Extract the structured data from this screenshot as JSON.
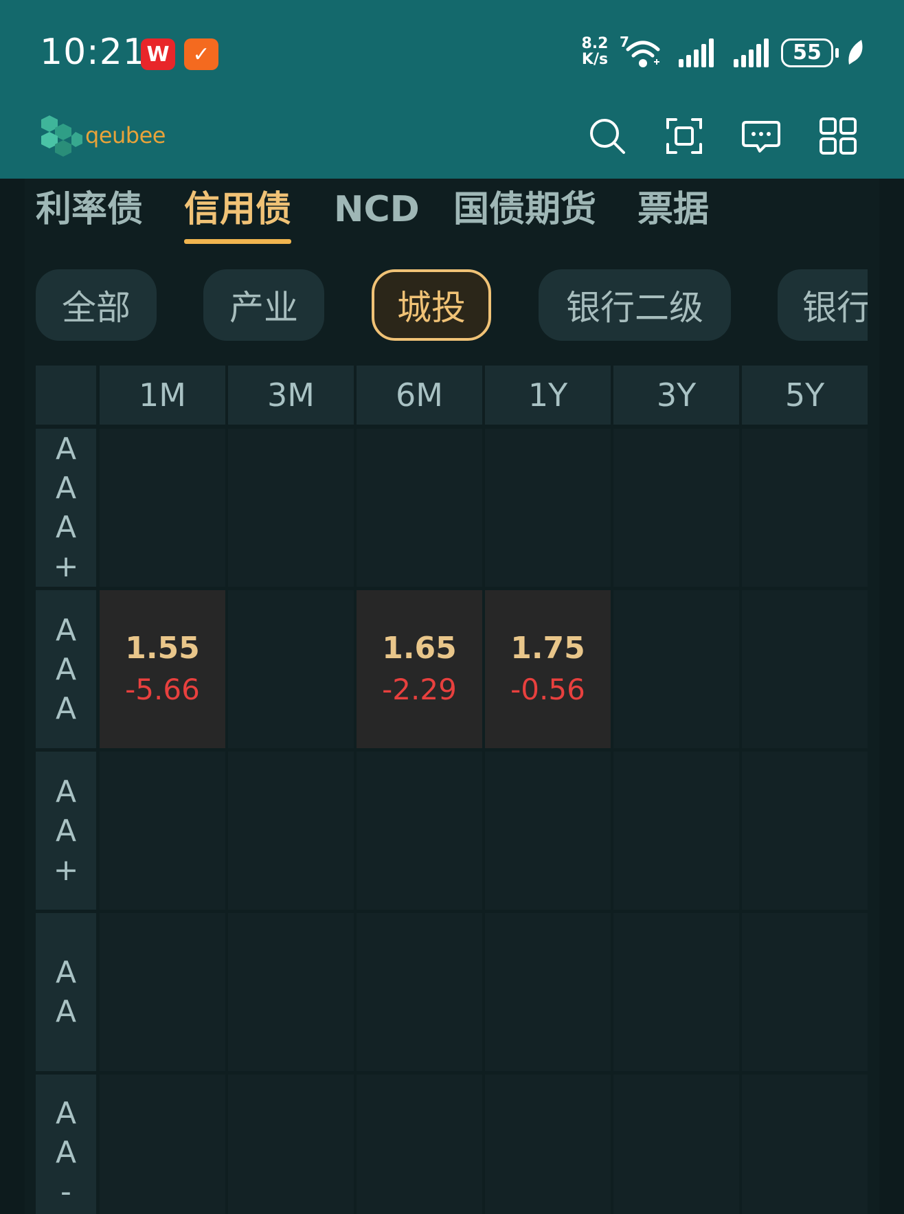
{
  "status_bar": {
    "time": "10:21",
    "app_badges": [
      "W",
      "✓"
    ],
    "net_speed_value": "8.2",
    "net_speed_unit": "K/s",
    "wifi_badge": "7",
    "battery": "55",
    "colors": {
      "bar": "#14696c"
    }
  },
  "header": {
    "logo_text": "qeubee",
    "icons": [
      "search-icon",
      "scan-icon",
      "message-icon",
      "apps-grid-icon"
    ]
  },
  "tabs": {
    "items": [
      "利率债",
      "信用债",
      "NCD",
      "国债期货",
      "票据"
    ],
    "active": "信用债"
  },
  "filters": {
    "items": [
      "全部",
      "产业",
      "城投",
      "银行二级",
      "银行"
    ],
    "active": "城投"
  },
  "grid": {
    "columns": [
      "1M",
      "3M",
      "6M",
      "1Y",
      "3Y",
      "5Y"
    ],
    "rows": [
      {
        "rating": [
          "A",
          "A",
          "A",
          "+"
        ],
        "cells": [
          null,
          null,
          null,
          null,
          null,
          null
        ]
      },
      {
        "rating": [
          "A",
          "A",
          "A"
        ],
        "cells": [
          {
            "value": "1.55",
            "change": "-5.66"
          },
          null,
          {
            "value": "1.65",
            "change": "-2.29"
          },
          {
            "value": "1.75",
            "change": "-0.56"
          },
          null,
          null
        ]
      },
      {
        "rating": [
          "A",
          "A",
          "+"
        ],
        "cells": [
          null,
          null,
          null,
          null,
          null,
          null
        ]
      },
      {
        "rating": [
          "A",
          "A"
        ],
        "cells": [
          null,
          null,
          null,
          null,
          null,
          null
        ]
      },
      {
        "rating": [
          "A",
          "A",
          "-"
        ],
        "cells": [
          null,
          null,
          null,
          null,
          null,
          null
        ]
      }
    ],
    "colors": {
      "value": "#e9c68a",
      "change_negative": "#e8403e",
      "active": "#f0c276"
    }
  }
}
